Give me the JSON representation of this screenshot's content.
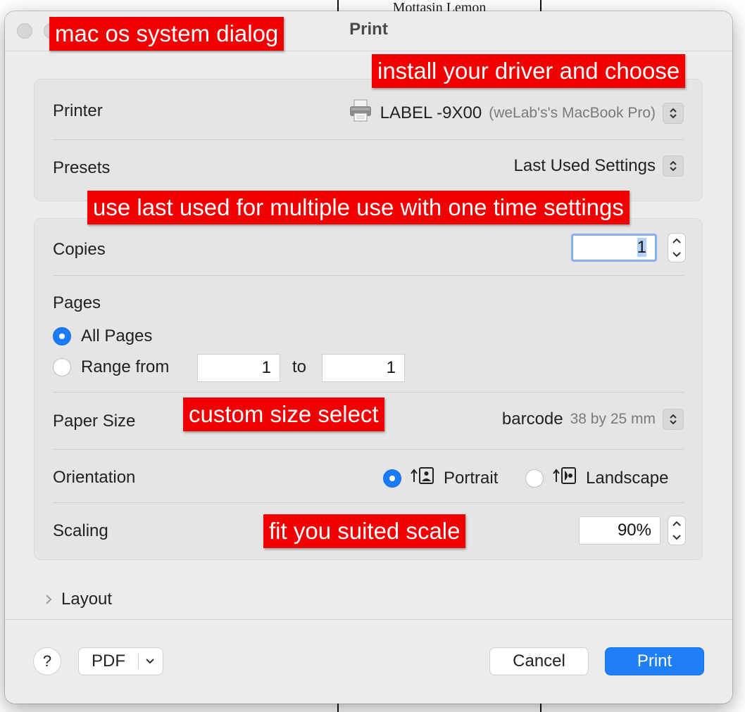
{
  "background": {
    "page_text": "Mottasin Lemon"
  },
  "window": {
    "title": "Print"
  },
  "printer": {
    "label": "Printer",
    "name": "LABEL -9X00",
    "host": "(weLab's's MacBook Pro)"
  },
  "presets": {
    "label": "Presets",
    "value": "Last Used Settings"
  },
  "copies": {
    "label": "Copies",
    "value": "1"
  },
  "pages": {
    "label": "Pages",
    "all_label": "All Pages",
    "range_label": "Range from",
    "from_value": "1",
    "to_label": "to",
    "to_value": "1"
  },
  "paper_size": {
    "label": "Paper Size",
    "value": "barcode",
    "detail": "38 by 25 mm"
  },
  "orientation": {
    "label": "Orientation",
    "portrait": "Portrait",
    "landscape": "Landscape",
    "selected": "Portrait"
  },
  "scaling": {
    "label": "Scaling",
    "value": "90%"
  },
  "layout": {
    "label": "Layout"
  },
  "footer": {
    "help": "?",
    "pdf": "PDF",
    "cancel": "Cancel",
    "print": "Print"
  },
  "annotations": {
    "dialog": "mac os system dialog",
    "driver": "install your driver and choose",
    "last_used": "use last used for multiple use with one time settings",
    "custom_size": "custom size select",
    "scale": "fit you suited scale"
  },
  "colors": {
    "accent": "#1f7ff7",
    "annotation": "#f00000",
    "dialog_bg": "#ececec"
  }
}
